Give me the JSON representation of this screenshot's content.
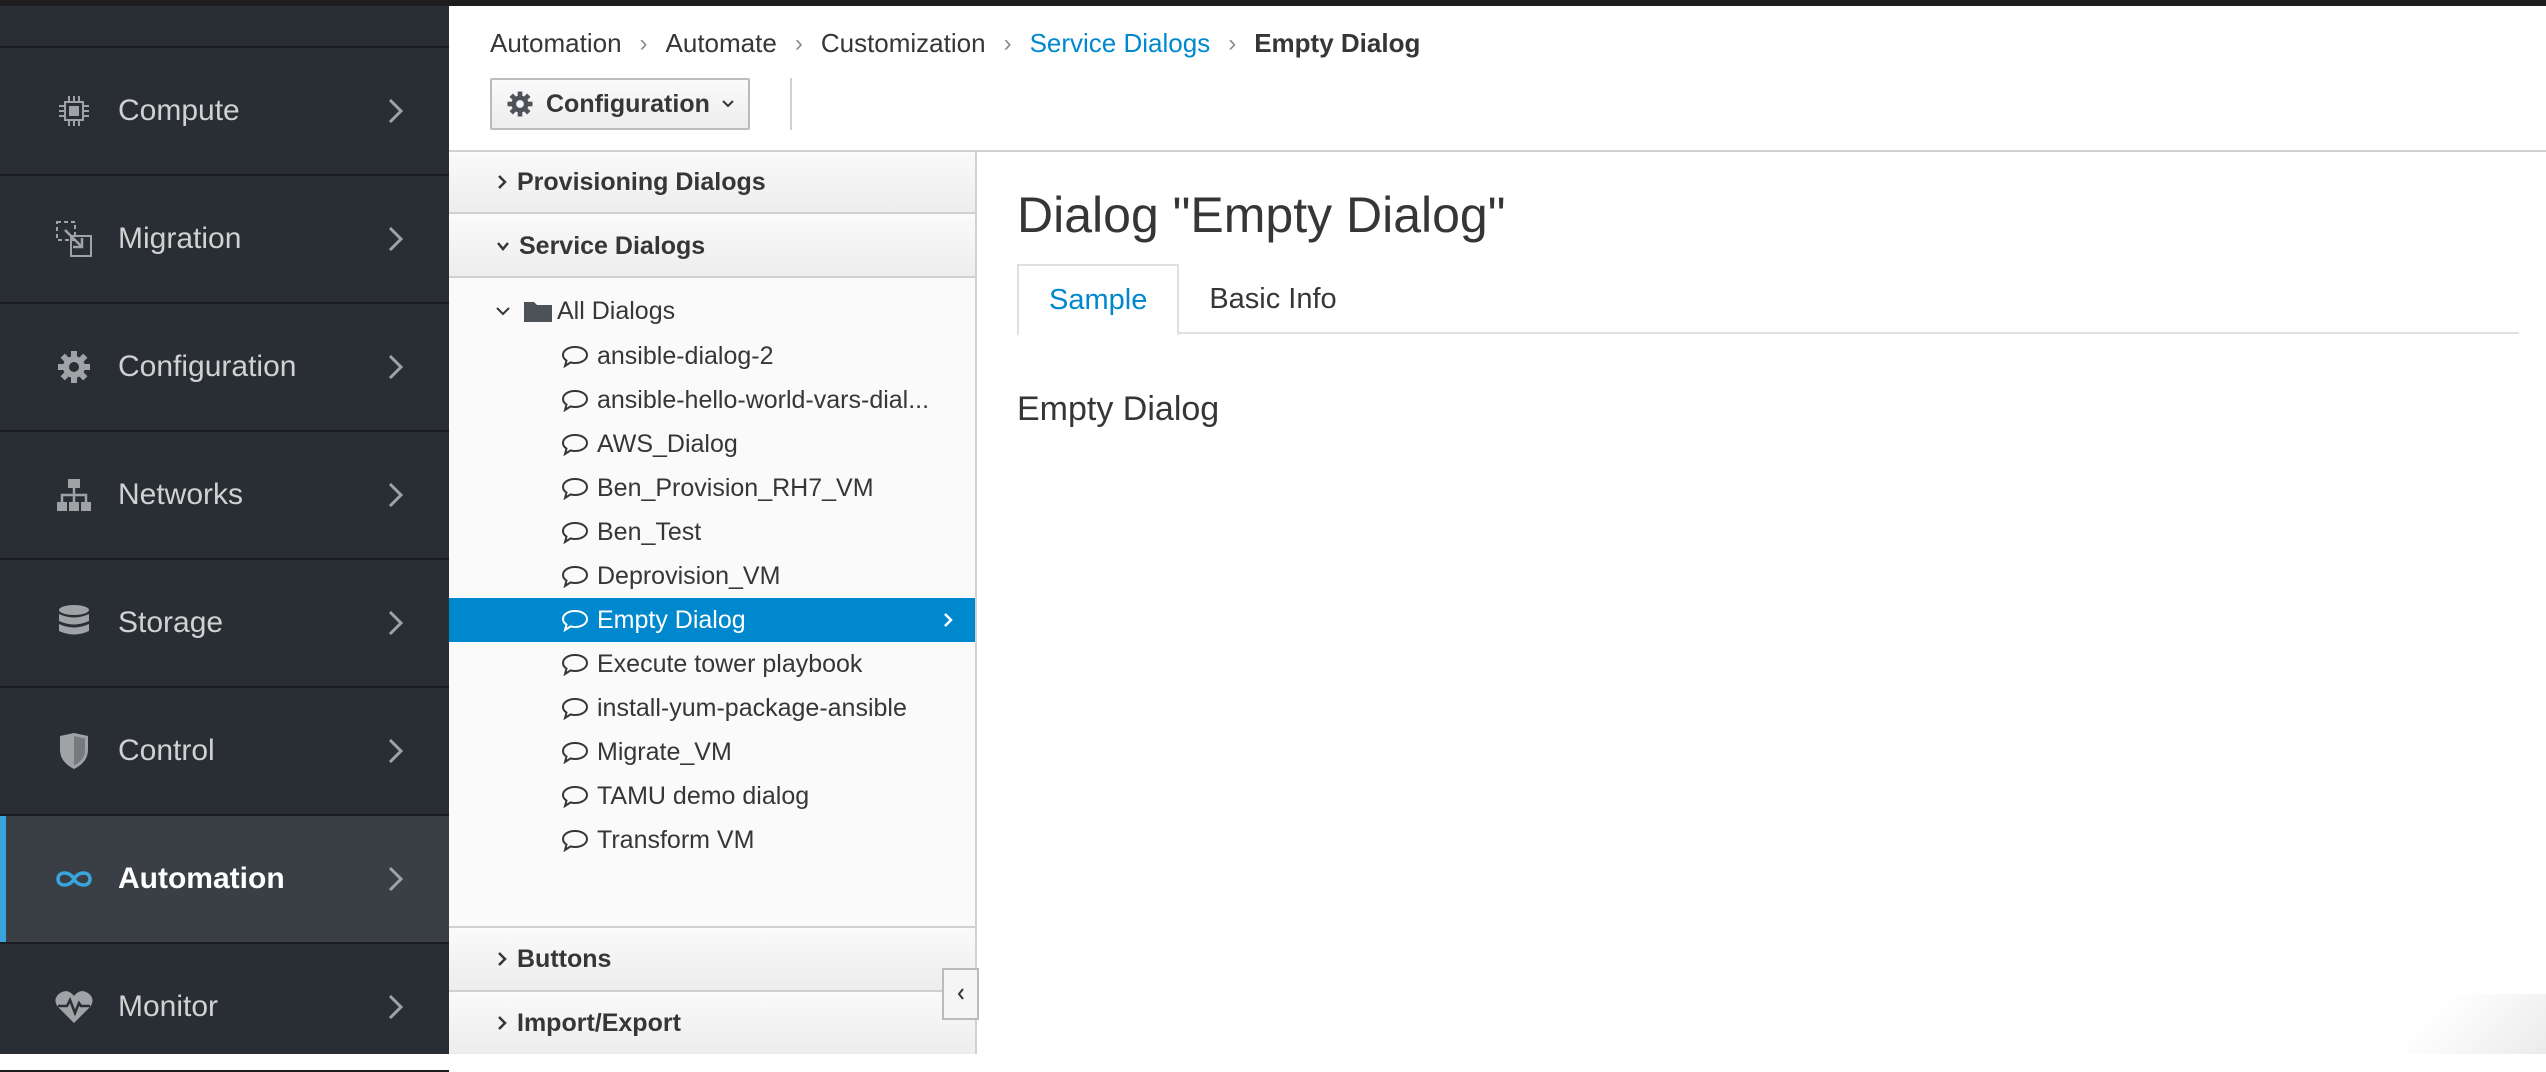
{
  "nav": {
    "items": [
      {
        "label": "Compute",
        "icon": "chip-icon"
      },
      {
        "label": "Migration",
        "icon": "migration-icon"
      },
      {
        "label": "Configuration",
        "icon": "gear-icon"
      },
      {
        "label": "Networks",
        "icon": "network-icon"
      },
      {
        "label": "Storage",
        "icon": "database-icon"
      },
      {
        "label": "Control",
        "icon": "shield-icon"
      },
      {
        "label": "Automation",
        "icon": "infinity-icon",
        "active": true
      },
      {
        "label": "Monitor",
        "icon": "heartbeat-icon"
      }
    ]
  },
  "breadcrumb": {
    "items": [
      "Automation",
      "Automate",
      "Customization",
      "Service Dialogs",
      "Empty Dialog"
    ]
  },
  "toolbar": {
    "configuration_label": "Configuration"
  },
  "accordion": {
    "provisioning_dialogs": "Provisioning Dialogs",
    "service_dialogs": "Service Dialogs",
    "buttons": "Buttons",
    "import_export": "Import/Export"
  },
  "tree": {
    "root_label": "All Dialogs",
    "items": [
      "ansible-dialog-2",
      "ansible-hello-world-vars-dial...",
      "AWS_Dialog",
      "Ben_Provision_RH7_VM",
      "Ben_Test",
      "Deprovision_VM",
      "Empty Dialog",
      "Execute tower playbook",
      "install-yum-package-ansible",
      "Migrate_VM",
      "TAMU demo dialog",
      "Transform VM"
    ],
    "selected": "Empty Dialog"
  },
  "main": {
    "title": "Dialog \"Empty Dialog\"",
    "tabs": [
      "Sample",
      "Basic Info"
    ],
    "active_tab": "Sample",
    "dialog_heading": "Empty Dialog"
  },
  "colors": {
    "nav_bg": "#292e34",
    "accent": "#0088ce",
    "active_marker": "#39a5dc"
  }
}
